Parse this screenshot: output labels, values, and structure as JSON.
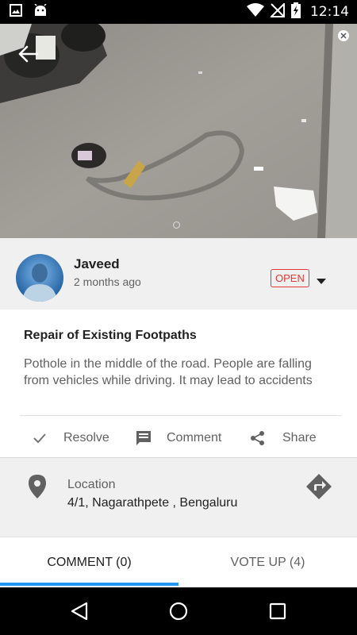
{
  "status_bar": {
    "time": "12:14",
    "left_icons": [
      "image-icon",
      "android-icon"
    ],
    "right_icons": [
      "wifi-icon",
      "signal-off-icon",
      "battery-charging-icon"
    ]
  },
  "hero": {
    "back_icon": "arrow-back-icon",
    "pager": {
      "count": 1,
      "active": 0
    }
  },
  "author": {
    "name": "Javeed",
    "time": "2 months ago",
    "status": "OPEN",
    "dropdown_icon": "caret-down-icon"
  },
  "post": {
    "title": "Repair of Existing Footpaths",
    "description": "Pothole in the middle of the road.  People are falling from vehicles while driving.  It may lead to accidents"
  },
  "actions": [
    {
      "label": "Resolve",
      "icon": "check-icon"
    },
    {
      "label": "Comment",
      "icon": "comment-icon"
    },
    {
      "label": "Share",
      "icon": "share-icon"
    }
  ],
  "location": {
    "label": "Location",
    "value": "4/1, Nagarathpete , Bengaluru",
    "icon": "location-pin-icon",
    "directions_icon": "directions-icon"
  },
  "tabs": [
    {
      "label": "COMMENT (0)",
      "active": true
    },
    {
      "label": "VOTE UP (4)",
      "active": false
    }
  ],
  "colors": {
    "status_open": "#e53935",
    "tab_indicator": "#2196f3",
    "section_bg": "#f0f0f0",
    "icon_gray": "#616161"
  },
  "nav_bar": {
    "buttons": [
      "back-triangle-icon",
      "home-circle-icon",
      "recents-square-icon"
    ]
  }
}
